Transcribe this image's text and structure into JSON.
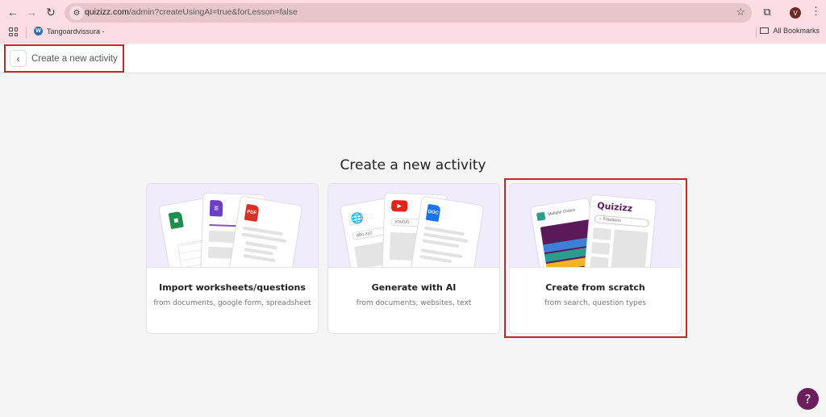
{
  "browser": {
    "url_domain": "quizizz.com",
    "url_path": "/admin?createUsingAI=true&forLesson=false",
    "icons": {
      "back": "←",
      "forward": "→",
      "reload": "↻",
      "site_settings": "⚙",
      "bookmark_star": "☆",
      "extensions": "⧉",
      "menu": "⋮"
    },
    "profile_initial": "V",
    "bookmarks": [
      {
        "label": "Tangoardvissura -",
        "icon": "wordpress-icon"
      }
    ],
    "all_bookmarks_label": "All Bookmarks"
  },
  "header": {
    "back_icon": "‹",
    "title": "Create a new activity"
  },
  "main": {
    "title": "Create a new activity",
    "cards": [
      {
        "title": "Import worksheets/questions",
        "subtitle": "from documents, google form, spreadsheet",
        "badges": {
          "sheets": "▦",
          "forms": "☰",
          "pdf": "PDF"
        }
      },
      {
        "title": "Generate with AI",
        "subtitle": "from documents, websites, text",
        "badges": {
          "web": "🌐",
          "web_url": "abc.xyz",
          "youtube": "▶",
          "youtube_url": "youtub",
          "doc": "DOC"
        }
      },
      {
        "title": "Create from scratch",
        "subtitle": "from search, question types",
        "badges": {
          "mc_label": "Multiple Choice",
          "brand": "Quizizz",
          "search_text": "Fractions"
        }
      }
    ]
  },
  "help": {
    "label": "?"
  },
  "colors": {
    "highlight": "#c8242d",
    "brand": "#6c1d5e",
    "illustration_bg": "#f1ecfb"
  }
}
